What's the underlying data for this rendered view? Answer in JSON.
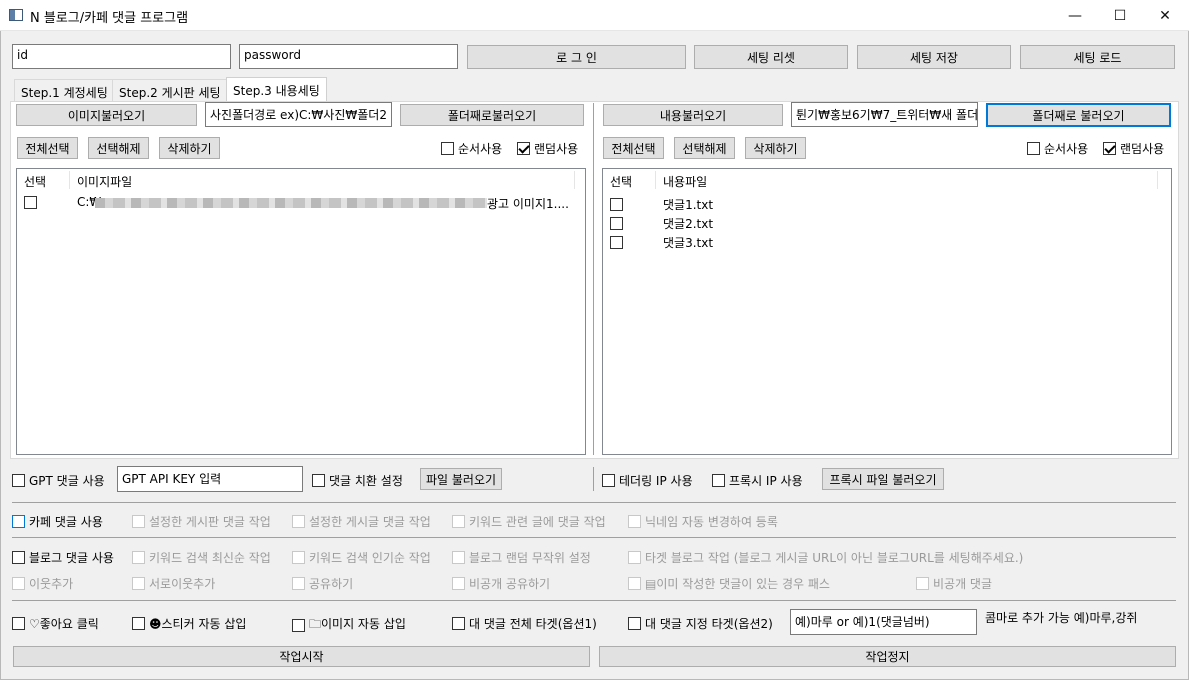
{
  "window": {
    "title": "N 블로그/카페 댓글 프로그램",
    "minimize": "—",
    "maximize": "☐",
    "close": "✕"
  },
  "login": {
    "id_value": "id",
    "password_value": "password",
    "login_label": "로 그 인",
    "reset_label": "세팅 리셋",
    "save_label": "세팅 저장",
    "load_label": "세팅 로드"
  },
  "tabs": [
    "Step.1 계정세팅",
    "Step.2 게시판 세팅",
    "Step.3 내용세팅"
  ],
  "left": {
    "image_load_label": "이미지불러오기",
    "path_value": "사진폴더경로 ex)C:₩사진₩폴더2",
    "folder_load_label": "폴더째로불러오기",
    "select_all": "전체선택",
    "deselect": "선택해제",
    "delete": "삭제하기",
    "sequential": "순서사용",
    "random": "랜덤사용",
    "col_select": "선택",
    "col_file": "이미지파일",
    "rows": [
      {
        "file_prefix": "C:₩",
        "file_suffix": "광고 이미지1...."
      }
    ]
  },
  "right": {
    "content_load_label": "내용불러오기",
    "path_value": "튄기₩홍보6기₩7_트위터₩새 폴더",
    "folder_load_label": "폴더째로 불러오기",
    "select_all": "전체선택",
    "deselect": "선택해제",
    "delete": "삭제하기",
    "sequential": "순서사용",
    "random": "랜덤사용",
    "col_select": "선택",
    "col_file": "내용파일",
    "rows": [
      "댓글1.txt",
      "댓글2.txt",
      "댓글3.txt"
    ]
  },
  "gpt": {
    "use": "GPT 댓글 사용",
    "key_value": "GPT API KEY 입력",
    "replace": "댓글 치환 설정",
    "file_load": "파일 불러오기"
  },
  "proxy": {
    "tethering": "테더링 IP 사용",
    "proxy": "프록시 IP 사용",
    "proxy_file": "프록시 파일 불러오기"
  },
  "cafe": {
    "use": "카페 댓글 사용",
    "options": [
      "설정한 게시판 댓글 작업",
      "설정한 게시글 댓글 작업",
      "키워드 관련 글에 댓글 작업",
      "닉네임 자동 변경하여 등록"
    ]
  },
  "blog": {
    "use": "블로그 댓글 사용",
    "options": [
      "키워드 검색 최신순 작업",
      "키워드 검색 인기순 작업",
      "블로그 랜덤 무작위 설정",
      "타겟 블로그 작업 (블로그 게시글 URL이 아닌 블로그URL를 세팅해주세요.)"
    ],
    "options2": [
      "이웃추가",
      "서로이웃추가",
      "공유하기",
      "비공개 공유하기",
      "▤이미 작성한 댓글이 있는 경우 패스",
      "비공개 댓글"
    ]
  },
  "extra": {
    "like": "♡좋아요 클릭",
    "sticker": "☻스티커 자동 삽입",
    "image": "🗀이미지 자동 삽입",
    "reply_all": "대 댓글 전체 타겟(옵션1)",
    "reply_target": "대 댓글 지정 타겟(옵션2)",
    "target_value": "예)마루 or 예)1(댓글넘버)",
    "note": "콤마로 추가 가능 예)마루,강쥐"
  },
  "actions": {
    "start": "작업시작",
    "stop": "작업정지"
  }
}
